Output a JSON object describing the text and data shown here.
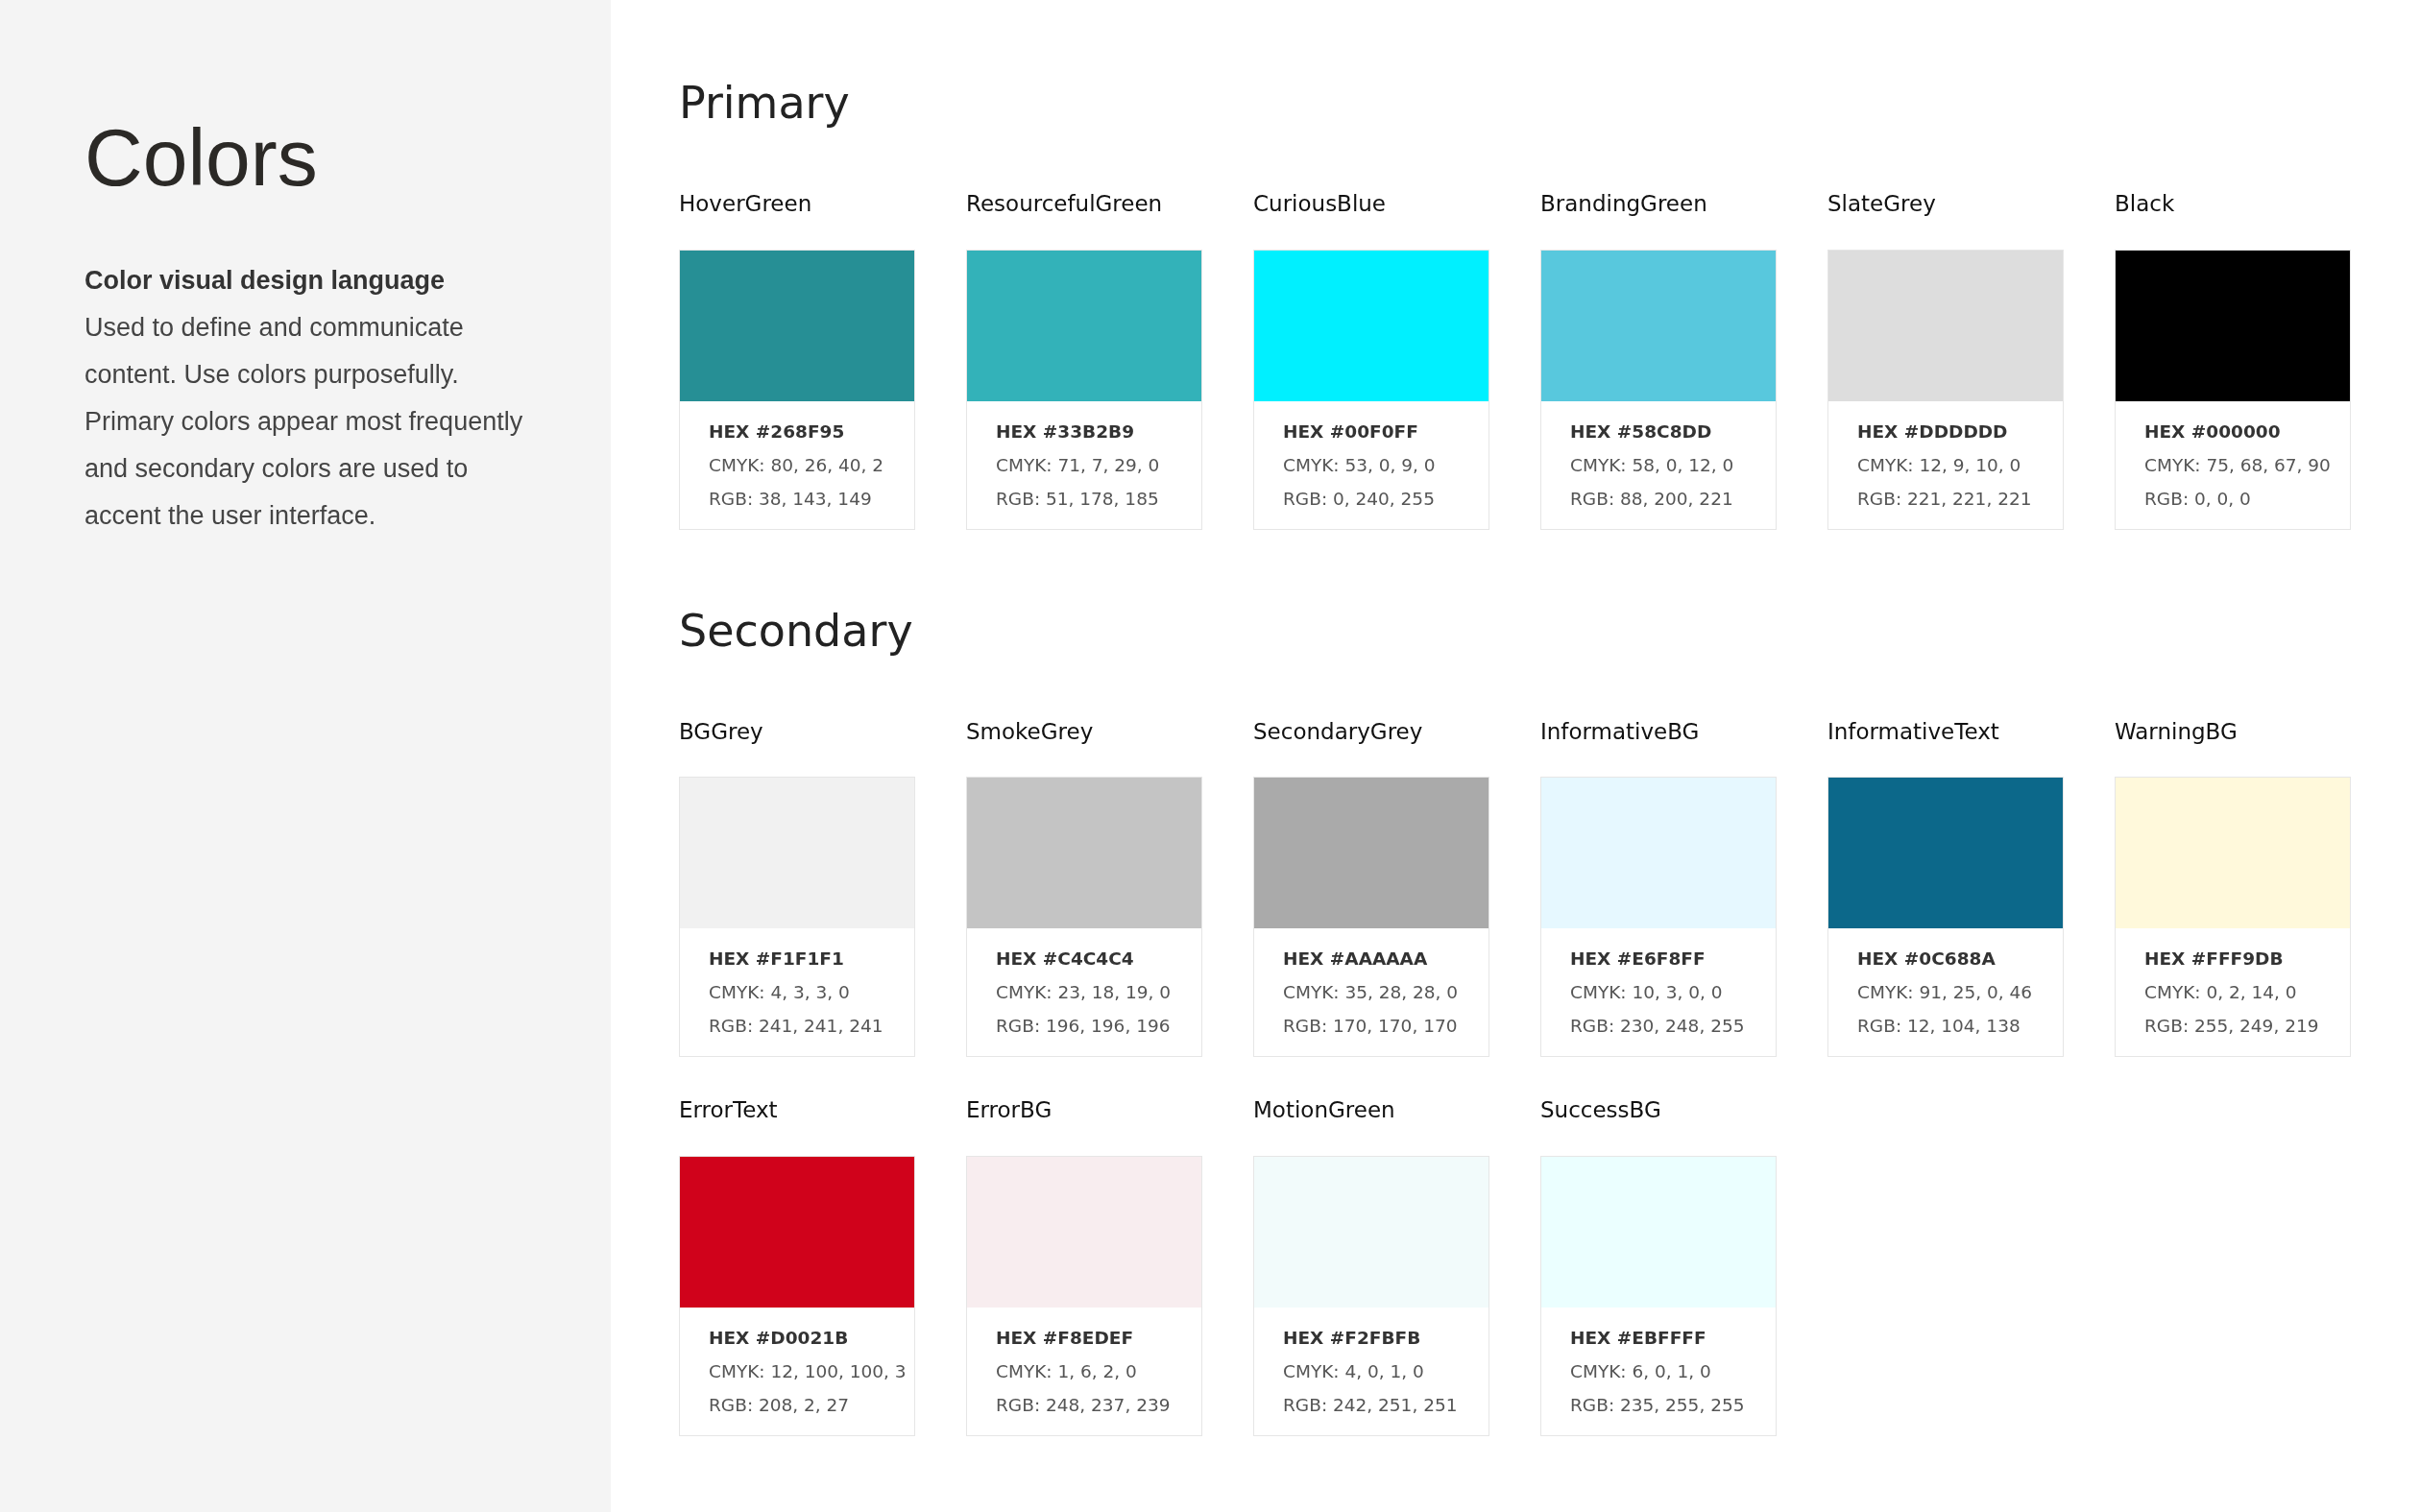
{
  "sidebar": {
    "title": "Colors",
    "subtitle": "Color visual design language",
    "description": "Used to define and communicate content. Use colors purposefully. Primary colors appear most frequently and secondary colors are used to accent the user interface."
  },
  "sections": [
    {
      "title": "Primary",
      "colors": [
        {
          "name": "HoverGreen",
          "color": "#268f95",
          "hex": "HEX #268F95",
          "cmyk": "CMYK: 80, 26, 40, 2",
          "rgb": "RGB: 38, 143, 149"
        },
        {
          "name": "ResourcefulGreen",
          "color": "#33b2b9",
          "hex": "HEX #33B2B9",
          "cmyk": "CMYK: 71, 7, 29, 0",
          "rgb": "RGB: 51, 178, 185"
        },
        {
          "name": "CuriousBlue",
          "color": "#00f0ff",
          "hex": "HEX #00F0FF",
          "cmyk": "CMYK: 53, 0, 9, 0",
          "rgb": "RGB: 0, 240, 255"
        },
        {
          "name": "BrandingGreen",
          "color": "#58c8dd",
          "hex": "HEX #58C8DD",
          "cmyk": "CMYK: 58, 0, 12, 0",
          "rgb": "RGB: 88, 200, 221"
        },
        {
          "name": "SlateGrey",
          "color": "#dddddd",
          "hex": "HEX #DDDDDD",
          "cmyk": "CMYK: 12, 9, 10, 0",
          "rgb": "RGB: 221, 221, 221"
        },
        {
          "name": "Black",
          "color": "#000000",
          "hex": "HEX #000000",
          "cmyk": "CMYK: 75, 68, 67, 90",
          "rgb": "RGB: 0, 0, 0"
        }
      ]
    },
    {
      "title": "Secondary",
      "colors": [
        {
          "name": "BGGrey",
          "color": "#f1f1f1",
          "hex": "HEX #F1F1F1",
          "cmyk": "CMYK: 4, 3, 3, 0",
          "rgb": "RGB: 241, 241, 241"
        },
        {
          "name": "SmokeGrey",
          "color": "#c4c4c4",
          "hex": "HEX #C4C4C4",
          "cmyk": "CMYK: 23, 18, 19, 0",
          "rgb": "RGB: 196, 196, 196"
        },
        {
          "name": "SecondaryGrey",
          "color": "#aaaaaa",
          "hex": "HEX #AAAAAA",
          "cmyk": "CMYK: 35, 28, 28, 0",
          "rgb": "RGB: 170, 170, 170"
        },
        {
          "name": "InformativeBG",
          "color": "#e6f8ff",
          "hex": "HEX #E6F8FF",
          "cmyk": "CMYK: 10, 3, 0, 0",
          "rgb": "RGB: 230, 248, 255"
        },
        {
          "name": "InformativeText",
          "color": "#0c688a",
          "hex": "HEX #0C688A",
          "cmyk": "CMYK: 91, 25, 0, 46",
          "rgb": "RGB: 12, 104, 138"
        },
        {
          "name": "WarningBG",
          "color": "#fff9db",
          "hex": "HEX #FFF9DB",
          "cmyk": "CMYK: 0, 2, 14, 0",
          "rgb": "RGB: 255, 249, 219"
        },
        {
          "name": "ErrorText",
          "color": "#d0021b",
          "hex": "HEX #D0021B",
          "cmyk": "CMYK: 12, 100, 100, 3",
          "rgb": "RGB: 208, 2, 27"
        },
        {
          "name": "ErrorBG",
          "color": "#f8edef",
          "hex": "HEX #F8EDEF",
          "cmyk": "CMYK: 1, 6, 2, 0",
          "rgb": "RGB: 248, 237, 239"
        },
        {
          "name": "MotionGreen",
          "color": "#f2fbfb",
          "hex": "HEX #F2FBFB",
          "cmyk": "CMYK: 4, 0, 1, 0",
          "rgb": "RGB: 242, 251, 251"
        },
        {
          "name": "SuccessBG",
          "color": "#ebffff",
          "hex": "HEX #EBFFFF",
          "cmyk": "CMYK: 6, 0, 1, 0",
          "rgb": "RGB: 235, 255, 255"
        }
      ]
    }
  ]
}
